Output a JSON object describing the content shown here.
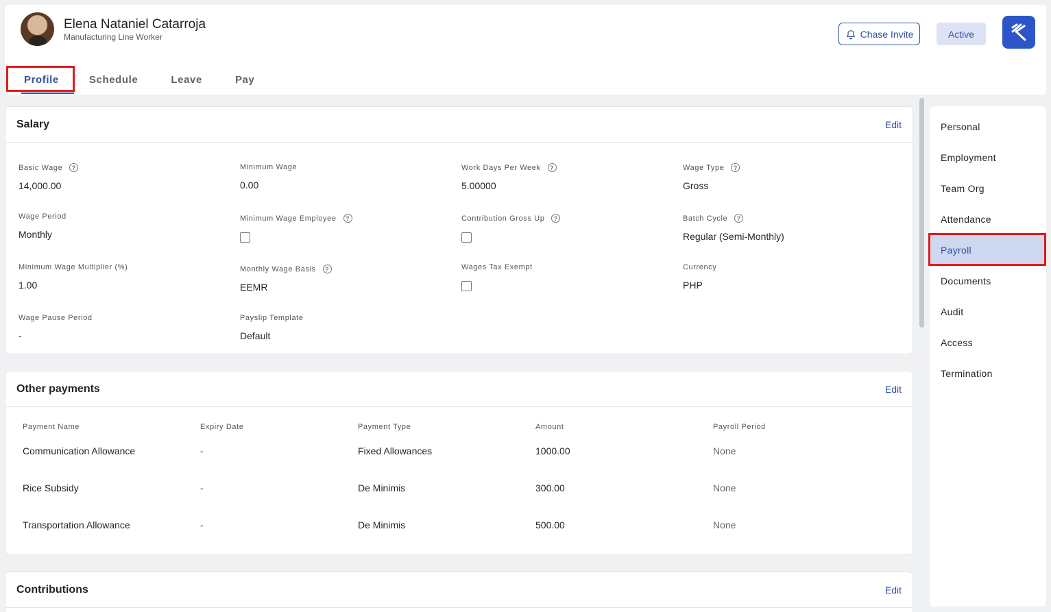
{
  "employee": {
    "name": "Elena Nataniel Catarroja",
    "role": "Manufacturing Line Worker"
  },
  "header": {
    "chase_invite_label": "Chase Invite",
    "status_label": "Active"
  },
  "tabs": [
    {
      "label": "Profile",
      "active": true
    },
    {
      "label": "Schedule"
    },
    {
      "label": "Leave"
    },
    {
      "label": "Pay"
    }
  ],
  "salary": {
    "title": "Salary",
    "edit_label": "Edit",
    "fields": {
      "basic_wage": {
        "label": "Basic Wage",
        "value": "14,000.00"
      },
      "minimum_wage": {
        "label": "Minimum Wage",
        "value": "0.00"
      },
      "work_days_per_week": {
        "label": "Work Days Per Week",
        "value": "5.00000"
      },
      "wage_type": {
        "label": "Wage Type",
        "value": "Gross"
      },
      "wage_period": {
        "label": "Wage Period",
        "value": "Monthly"
      },
      "minimum_wage_employee": {
        "label": "Minimum Wage Employee",
        "checked": false
      },
      "contribution_gross_up": {
        "label": "Contribution Gross Up",
        "checked": false
      },
      "batch_cycle": {
        "label": "Batch Cycle",
        "value": "Regular (Semi-Monthly)"
      },
      "minimum_wage_multiplier": {
        "label": "Minimum Wage Multiplier (%)",
        "value": "1.00"
      },
      "monthly_wage_basis": {
        "label": "Monthly Wage Basis",
        "value": "EEMR"
      },
      "wages_tax_exempt": {
        "label": "Wages Tax Exempt",
        "checked": false
      },
      "currency": {
        "label": "Currency",
        "value": "PHP"
      },
      "wage_pause_period": {
        "label": "Wage Pause Period",
        "value": "-"
      },
      "payslip_template": {
        "label": "Payslip Template",
        "value": "Default"
      }
    }
  },
  "other_payments": {
    "title": "Other payments",
    "edit_label": "Edit",
    "columns": [
      "Payment Name",
      "Expiry Date",
      "Payment Type",
      "Amount",
      "Payroll Period"
    ],
    "rows": [
      [
        "Communication Allowance",
        "-",
        "Fixed Allowances",
        "1000.00",
        "None"
      ],
      [
        "Rice Subsidy",
        "-",
        "De Minimis",
        "300.00",
        "None"
      ],
      [
        "Transportation Allowance",
        "-",
        "De Minimis",
        "500.00",
        "None"
      ]
    ]
  },
  "contributions": {
    "title": "Contributions",
    "edit_label": "Edit"
  },
  "sidenav": {
    "items": [
      "Personal",
      "Employment",
      "Team Org",
      "Attendance",
      "Payroll",
      "Documents",
      "Audit",
      "Access",
      "Termination"
    ],
    "selected": "Payroll"
  },
  "colors": {
    "accent": "#2f4fa0",
    "logo_bg": "#2c55c9",
    "highlight_box": "#e01b1b",
    "selected_nav_bg": "#cfd8f1"
  }
}
